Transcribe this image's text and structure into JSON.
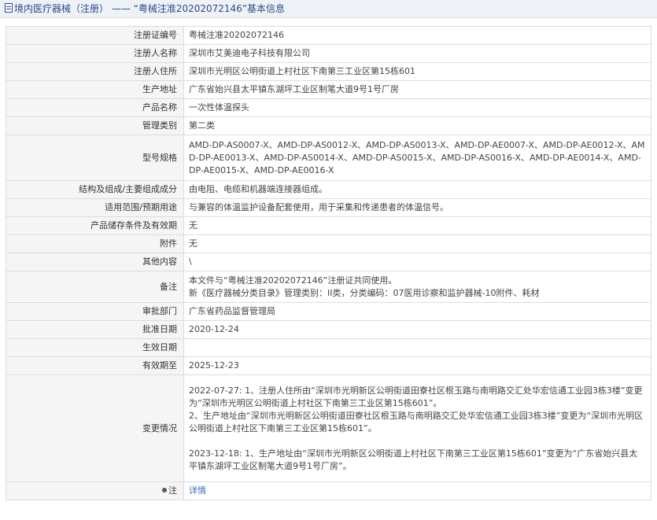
{
  "header": {
    "title": "境内医疗器械（注册） —— “粤械注准20202072146”基本信息",
    "icon": "document-icon"
  },
  "rows": [
    {
      "label": "注册证编号",
      "value": "粤械注准20202072146"
    },
    {
      "label": "注册人名称",
      "value": "深圳市艾美迪电子科技有限公司"
    },
    {
      "label": "注册人住所",
      "value": "深圳市光明区公明街道上村社区下南第三工业区第15栋601"
    },
    {
      "label": "生产地址",
      "value": "广东省始兴县太平镇东湖坪工业区制笔大道9号1号厂房"
    },
    {
      "label": "产品名称",
      "value": "一次性体温探头"
    },
    {
      "label": "管理类别",
      "value": "第二类"
    },
    {
      "label": "型号规格",
      "value": "AMD-DP-AS0007-X、AMD-DP-AS0012-X、AMD-DP-AS0013-X、AMD-DP-AE0007-X、AMD-DP-AE0012-X、AMD-DP-AE0013-X、AMD-DP-AS0014-X、AMD-DP-AS0015-X、AMD-DP-AS0016-X、AMD-DP-AE0014-X、AMD-DP-AE0015-X、AMD-DP-AE0016-X"
    },
    {
      "label": "结构及组成/主要组成成分",
      "value": "由电阻、电缆和机器端连接器组成。"
    },
    {
      "label": "适用范围/预期用途",
      "value": "与兼容的体温监护设备配套使用，用于采集和传递患者的体温信号。"
    },
    {
      "label": "产品储存条件及有效期",
      "value": "无"
    },
    {
      "label": "附件",
      "value": "无"
    },
    {
      "label": "其他内容",
      "value": "\\"
    },
    {
      "label": "备注",
      "value": "本文件与“粤械注准20202072146”注册证共同使用。\n新《医疗器械分类目录》管理类别：II类，分类编码：07医用诊察和监护器械-10附件、耗材"
    },
    {
      "label": "审批部门",
      "value": "广东省药品监督管理局"
    },
    {
      "label": "批准日期",
      "value": "2020-12-24"
    },
    {
      "label": "生效日期",
      "value": ""
    },
    {
      "label": "有效期至",
      "value": "2025-12-23"
    },
    {
      "label": "变更情况",
      "value": "2022-07-27: 1、注册人住所由“深圳市光明新区公明街道田寮社区根玉路与南明路交汇处华宏信通工业园3栋3楼”变更为“深圳市光明区公明街道上村社区下南第三工业区第15栋601”。\n2、生产地址由“深圳市光明新区公明街道田寮社区根玉路与南明路交汇处华宏信通工业园3栋3楼”变更为“深圳市光明区公明街道上村社区下南第三工业区第15栋601”。\n\n2023-12-18: 1、生产地址由“深圳市光明新区公明街道上村社区下南第三工业区第15栋601”变更为“广东省始兴县太平镇东湖坪工业区制笔大道9号1号厂房”。"
    }
  ],
  "footer": {
    "label": "注",
    "icon": "pin-icon",
    "link": "详情"
  }
}
